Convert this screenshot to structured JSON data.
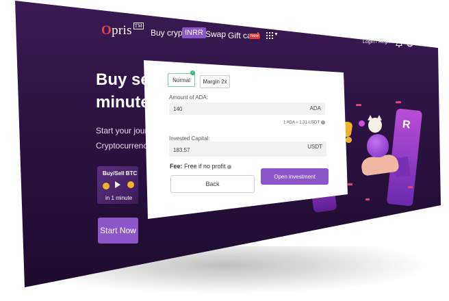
{
  "header": {
    "logo": "Opris",
    "logo_mark": "TM",
    "nav_buy_crypto": "Buy crypto",
    "badge_inrr": "INRR",
    "nav_swap": "Swap",
    "nav_gift_card": "Gift card",
    "badge_new": "New",
    "login_register": "Login / Register"
  },
  "hero": {
    "title_line1": "Buy sel",
    "title_line2": "minute",
    "sub_line1": "Start your journe",
    "sub_line2": "Cryptocurrencie",
    "promo_title": "Buy/Sell BTC",
    "promo_sub": "in 1 minute",
    "start_button": "Start Now"
  },
  "form": {
    "tab_normal": "Normal",
    "tab_margin": "Margin 2x",
    "amount_label": "Amount of ADA:",
    "amount_value": "140",
    "amount_unit": "ADA",
    "rate": "1 ADA ≈ 1.31 USDT",
    "capital_label": "Invested Capital:",
    "capital_value": "183.57",
    "capital_unit": "USDT",
    "fee_label": "Fee:",
    "fee_value": "Free if no profit",
    "back_button": "Back",
    "open_button": "Open investment"
  },
  "colors": {
    "accent": "#8a56c8",
    "background": "#2a1240",
    "new_badge": "#e0393c"
  },
  "icons": [
    "apps-grid-icon",
    "chevron-down-icon",
    "bell-icon",
    "globe-icon",
    "check-icon",
    "info-icon",
    "play-icon"
  ]
}
